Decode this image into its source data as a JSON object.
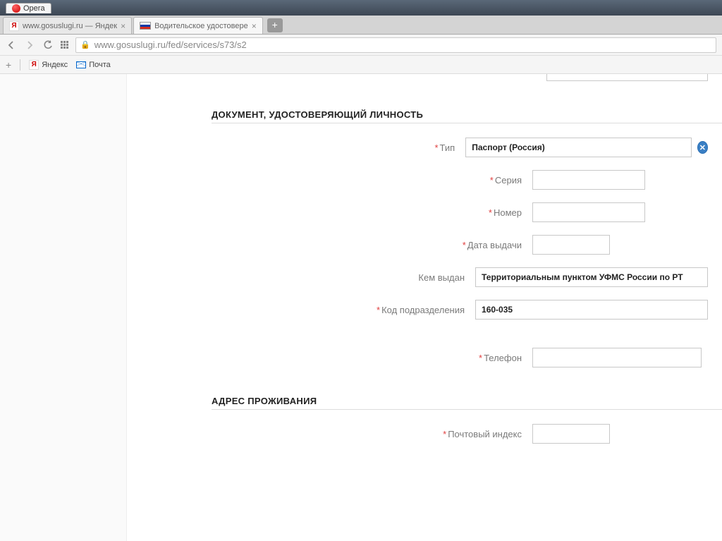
{
  "window": {
    "app_name": "Opera"
  },
  "tabs": [
    {
      "title": "www.gosuslugi.ru — Яндек"
    },
    {
      "title": "Водительское удостовере"
    }
  ],
  "nav": {
    "url": "www.gosuslugi.ru/fed/services/s73/s2"
  },
  "bookmarks": {
    "yandex": "Яндекс",
    "mail": "Почта"
  },
  "form": {
    "section1_title": "ДОКУМЕНТ, УДОСТОВЕРЯЮЩИЙ ЛИЧНОСТЬ",
    "type_label": "Тип",
    "type_value": "Паспорт (Россия)",
    "series_label": "Серия",
    "series_value": "",
    "number_label": "Номер",
    "number_value": "",
    "issue_date_label": "Дата выдачи",
    "issue_date_value": "",
    "issued_by_label": "Кем выдан",
    "issued_by_value": "Территориальным пунктом УФМС России по РТ",
    "dept_code_label": "Код подразделения",
    "dept_code_value": "160-035",
    "phone_label": "Телефон",
    "phone_value": "",
    "section2_title": "АДРЕС ПРОЖИВАНИЯ",
    "postcode_label": "Почтовый индекс",
    "postcode_value": ""
  }
}
